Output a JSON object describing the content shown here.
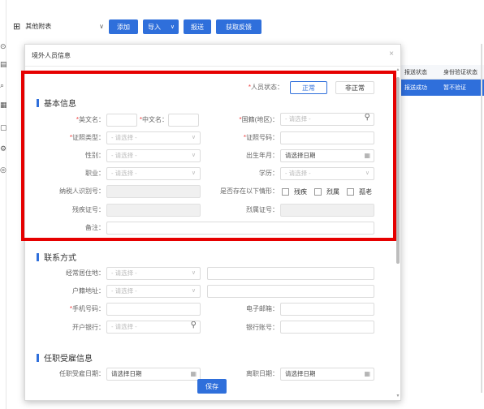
{
  "toolbar": {
    "menu_label": "其他附表",
    "add_label": "添加",
    "import_label": "导入",
    "submit_label": "报送",
    "feedback_label": "获取反馈"
  },
  "bg_table": {
    "col1": "报送状态",
    "col2": "身份验证状态",
    "row1_col1": "报送成功",
    "row1_col2": "暂不验证"
  },
  "dialog": {
    "title": "境外人员信息",
    "save_label": "保存"
  },
  "basic": {
    "section_title": "基本信息",
    "person_status_label": "人员状态：",
    "status_normal": "正常",
    "status_abnormal": "非正常",
    "english_name_label": "英文名：",
    "chinese_name_label": "中文名：",
    "nationality_label": "国籍(地区)：",
    "nationality_placeholder": "- 请选择 -",
    "id_type_label": "证照类型：",
    "id_type_placeholder": "- 请选择 -",
    "id_number_label": "证照号码：",
    "gender_label": "性别：",
    "gender_placeholder": "- 请选择 -",
    "birth_label": "出生年月：",
    "birth_placeholder": "请选择日期",
    "job_label": "职业：",
    "job_placeholder": "- 请选择 -",
    "edu_label": "学历：",
    "edu_placeholder": "- 请选择 -",
    "taxid_label": "纳税人识别号：",
    "situation_label": "是否存在以下情形：",
    "disabled_label": "残疾",
    "martyr_label": "烈属",
    "elderly_label": "孤老",
    "disability_cert_label": "残疾证号：",
    "martyr_cert_label": "烈属证号：",
    "remark_label": "备注："
  },
  "contact": {
    "section_title": "联系方式",
    "residence_label": "经常居住地：",
    "residence_placeholder": "- 请选择 -",
    "household_label": "户籍地址：",
    "household_placeholder": "- 请选择 -",
    "phone_label": "手机号码：",
    "email_label": "电子邮箱：",
    "bank_label": "开户银行：",
    "bank_placeholder": "- 请选择 -",
    "account_label": "银行账号："
  },
  "employment": {
    "section_title": "任职受雇信息",
    "hire_date_label": "任职受雇日期：",
    "hire_date_placeholder": "请选择日期",
    "leave_date_label": "离职日期：",
    "leave_date_placeholder": "请选择日期"
  },
  "colors": {
    "accent": "#2f6fdb",
    "highlight": "#e60000",
    "required": "#e44444"
  }
}
